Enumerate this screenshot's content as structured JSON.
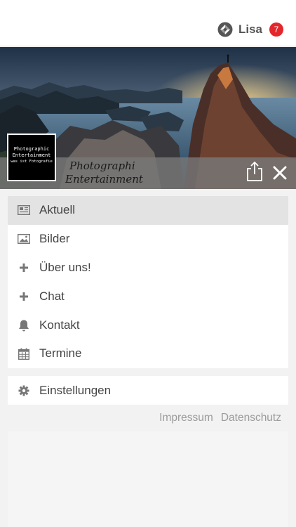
{
  "header": {
    "user_name": "Lisa",
    "notification_count": "7"
  },
  "brand": {
    "logo_lines": [
      "Photographic",
      "Entertainment",
      "was ist Fotografie"
    ],
    "name_line1": "Photographi",
    "name_line2": "Entertainment"
  },
  "menu": {
    "items": [
      {
        "label": "Aktuell",
        "icon": "newspaper-icon",
        "active": true
      },
      {
        "label": "Bilder",
        "icon": "image-icon"
      },
      {
        "label": "Über uns!",
        "icon": "plus-icon"
      },
      {
        "label": "Chat",
        "icon": "plus-icon"
      },
      {
        "label": "Kontakt",
        "icon": "bell-icon"
      },
      {
        "label": "Termine",
        "icon": "calendar-icon"
      }
    ],
    "settings_label": "Einstellungen"
  },
  "footer": {
    "impressum": "Impressum",
    "datenschutz": "Datenschutz"
  },
  "colors": {
    "badge": "#e3262b",
    "active_item": "#e3e3e3",
    "link": "#9b9b9b"
  }
}
